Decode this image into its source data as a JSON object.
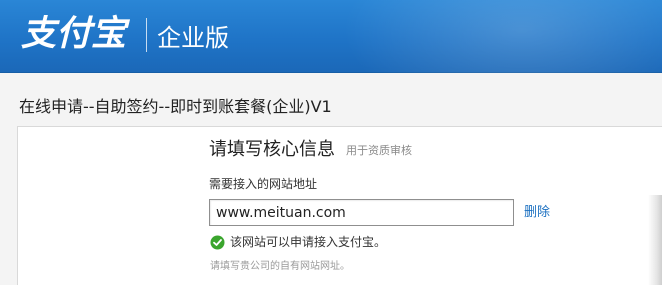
{
  "header": {
    "logo_text": "支付宝",
    "product_label": "企业版",
    "colors": {
      "bg": "#1f74c7",
      "text": "#ffffff"
    }
  },
  "page_title": "在线申请--自助签约--即时到账套餐(企业)V1",
  "form": {
    "section_title": "请填写核心信息",
    "section_subtitle": "用于资质审核",
    "field_label": "需要接入的网站地址",
    "url_value": "www.meituan.com",
    "delete_label": "删除",
    "status_icon": "check-circle-icon",
    "status_text": "该网站可以申请接入支付宝。",
    "hint": "请填写贵公司的自有网站网址。",
    "colors": {
      "link": "#1a6fc0",
      "success": "#3aa52d"
    }
  }
}
